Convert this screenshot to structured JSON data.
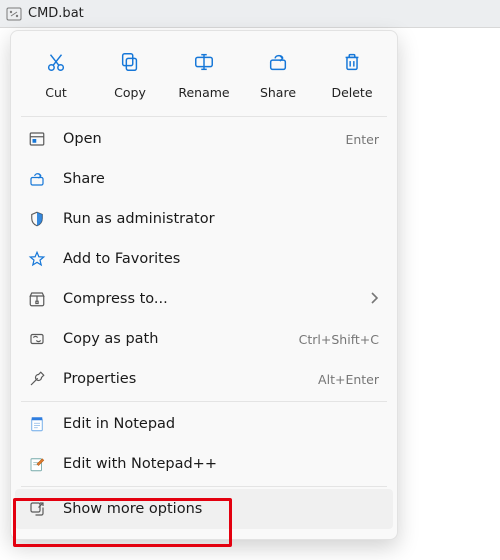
{
  "file": {
    "name": "CMD.bat"
  },
  "actions": {
    "cut": {
      "label": "Cut"
    },
    "copy": {
      "label": "Copy"
    },
    "rename": {
      "label": "Rename"
    },
    "share": {
      "label": "Share"
    },
    "delete": {
      "label": "Delete"
    }
  },
  "menu": {
    "open": {
      "label": "Open",
      "shortcut": "Enter"
    },
    "share": {
      "label": "Share",
      "shortcut": ""
    },
    "runAdmin": {
      "label": "Run as administrator",
      "shortcut": ""
    },
    "addFavorites": {
      "label": "Add to Favorites",
      "shortcut": ""
    },
    "compress": {
      "label": "Compress to...",
      "shortcut": ""
    },
    "copyPath": {
      "label": "Copy as path",
      "shortcut": "Ctrl+Shift+C"
    },
    "properties": {
      "label": "Properties",
      "shortcut": "Alt+Enter"
    },
    "editNotepad": {
      "label": "Edit in Notepad",
      "shortcut": ""
    },
    "editNotepadPlus": {
      "label": "Edit with Notepad++",
      "shortcut": ""
    },
    "showMore": {
      "label": "Show more options",
      "shortcut": ""
    }
  },
  "colors": {
    "accent": "#1677d8",
    "highlight": "#e3000f"
  }
}
